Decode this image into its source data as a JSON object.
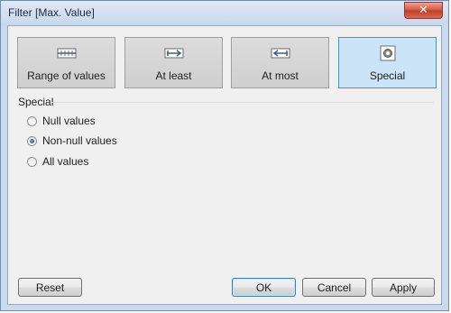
{
  "window": {
    "title": "Filter [Max. Value]",
    "close_glyph": "✕"
  },
  "modes": [
    {
      "label": "Range of values",
      "icon": "range-icon",
      "selected": false
    },
    {
      "label": "At least",
      "icon": "at-least-icon",
      "selected": false
    },
    {
      "label": "At most",
      "icon": "at-most-icon",
      "selected": false
    },
    {
      "label": "Special",
      "icon": "special-icon",
      "selected": true
    }
  ],
  "special": {
    "group_label": "Special",
    "options": [
      {
        "label": "Null values",
        "checked": false
      },
      {
        "label": "Non-null values",
        "checked": true
      },
      {
        "label": "All values",
        "checked": false
      }
    ]
  },
  "buttons": {
    "reset": "Reset",
    "ok": "OK",
    "cancel": "Cancel",
    "apply": "Apply"
  },
  "colors": {
    "selected_mode_bg": "#cce4f7",
    "selected_mode_border": "#26a0da",
    "close_button": "#c13c25"
  }
}
